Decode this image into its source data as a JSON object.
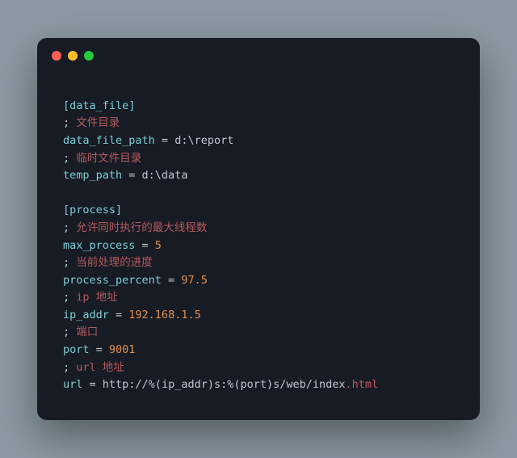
{
  "code": {
    "section1": "[data_file]",
    "c1_semi": "; ",
    "c1_text": "文件目录",
    "k1": "data_file_path",
    "eq": " = ",
    "v1": "d:\\report",
    "c2_semi": "; ",
    "c2_text": "临时文件目录",
    "k2": "temp_path",
    "v2": "d:\\data",
    "blank": " ",
    "section2": "[process]",
    "c3_semi": "; ",
    "c3_text": "允许同时执行的最大线程数",
    "k3": "max_process",
    "v3": "5",
    "c4_semi": "; ",
    "c4_text": "当前处理的进度",
    "k4": "process_percent",
    "v4": "97.5",
    "c5_semi": "; ",
    "c5_text": "ip 地址",
    "k5": "ip_addr",
    "v5": "192.168.1.5",
    "c6_semi": "; ",
    "c6_text": "端口",
    "k6": "port",
    "v6": "9001",
    "c7_semi": "; ",
    "c7_text": "url 地址",
    "k7": "url",
    "v7a": "http",
    "v7b": "://%(",
    "v7c": "ip_addr",
    "v7d": ")s:%(",
    "v7e": "port",
    "v7f": ")s/web/index",
    "v7g": ".html"
  }
}
